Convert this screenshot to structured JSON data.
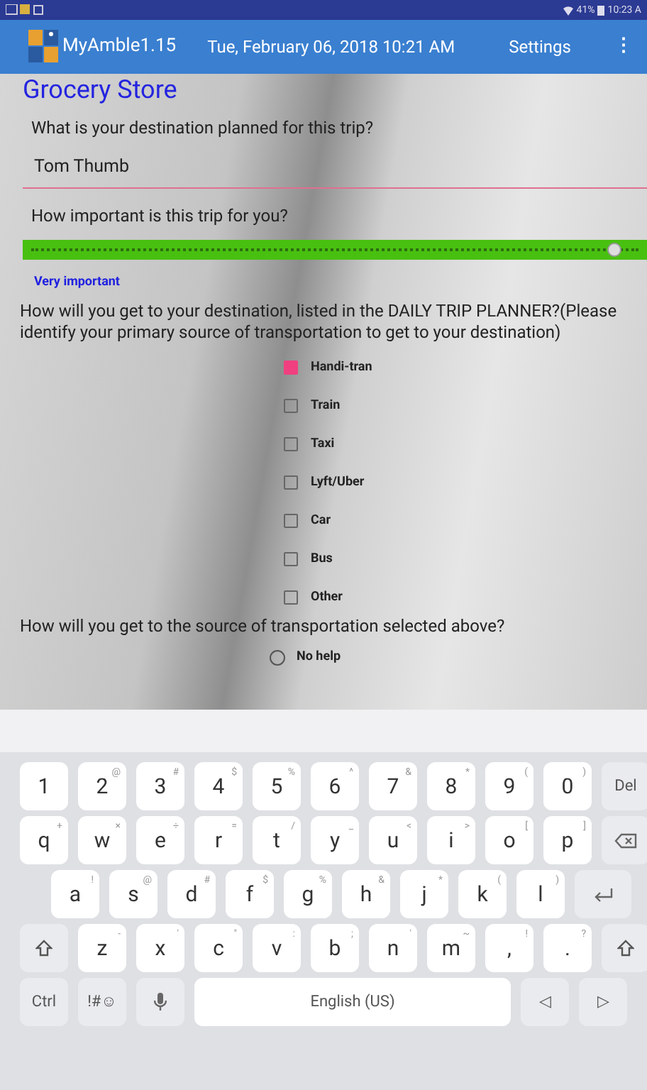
{
  "status_bar": {
    "battery": "41%",
    "time": "10:23 A"
  },
  "app_bar": {
    "title": "MyAmble1.15",
    "date": "Tue, February 06, 2018 10:21 AM",
    "settings": "Settings",
    "overflow": "⋮"
  },
  "form": {
    "title": "Grocery Store",
    "destination": {
      "question": "What is your destination planned for this trip?",
      "value": "Tom Thumb"
    },
    "importance": {
      "question": "How important is this trip for you?",
      "level": 0.96,
      "answer": "Very important"
    },
    "transport": {
      "question": "How will you get to your destination, listed in the DAILY TRIP PLANNER?(Please identify your primary source of transportation to get to your destination)",
      "options": [
        {
          "label": "Handi-tran",
          "checked": true
        },
        {
          "label": "Train",
          "checked": false
        },
        {
          "label": "Taxi",
          "checked": false
        },
        {
          "label": "Lyft/Uber",
          "checked": false
        },
        {
          "label": "Car",
          "checked": false
        },
        {
          "label": "Bus",
          "checked": false
        },
        {
          "label": "Other",
          "checked": false
        }
      ]
    },
    "help": {
      "question": "How will you get to the source of transportation selected above?",
      "options": [
        {
          "label": "No help",
          "selected": false
        }
      ]
    }
  },
  "keyboard": {
    "rows": [
      [
        {
          "kind": "char",
          "label": "1"
        },
        {
          "kind": "char",
          "label": "2",
          "hint": "@"
        },
        {
          "kind": "char",
          "label": "3",
          "hint": "#"
        },
        {
          "kind": "char",
          "label": "4",
          "hint": "$"
        },
        {
          "kind": "char",
          "label": "5",
          "hint": "%"
        },
        {
          "kind": "char",
          "label": "6",
          "hint": "^"
        },
        {
          "kind": "char",
          "label": "7",
          "hint": "&"
        },
        {
          "kind": "char",
          "label": "8",
          "hint": "*"
        },
        {
          "kind": "char",
          "label": "9",
          "hint": "("
        },
        {
          "kind": "char",
          "label": "0",
          "hint": ")"
        },
        {
          "kind": "func",
          "label": "Del"
        }
      ],
      [
        {
          "kind": "char",
          "label": "q",
          "hint": "+"
        },
        {
          "kind": "char",
          "label": "w",
          "hint": "×"
        },
        {
          "kind": "char",
          "label": "e",
          "hint": "÷"
        },
        {
          "kind": "char",
          "label": "r",
          "hint": "="
        },
        {
          "kind": "char",
          "label": "t",
          "hint": "/"
        },
        {
          "kind": "char",
          "label": "y",
          "hint": "_"
        },
        {
          "kind": "char",
          "label": "u",
          "hint": "<"
        },
        {
          "kind": "char",
          "label": "i",
          "hint": ">"
        },
        {
          "kind": "char",
          "label": "o",
          "hint": "["
        },
        {
          "kind": "char",
          "label": "p",
          "hint": "]"
        },
        {
          "kind": "backspace"
        }
      ],
      [
        {
          "kind": "char",
          "label": "a",
          "hint": "!"
        },
        {
          "kind": "char",
          "label": "s",
          "hint": "@"
        },
        {
          "kind": "char",
          "label": "d",
          "hint": "#"
        },
        {
          "kind": "char",
          "label": "f",
          "hint": "$"
        },
        {
          "kind": "char",
          "label": "g",
          "hint": "%"
        },
        {
          "kind": "char",
          "label": "h",
          "hint": "&"
        },
        {
          "kind": "char",
          "label": "j",
          "hint": "*"
        },
        {
          "kind": "char",
          "label": "k",
          "hint": "("
        },
        {
          "kind": "char",
          "label": "l",
          "hint": ")"
        },
        {
          "kind": "enter"
        }
      ],
      [
        {
          "kind": "shift"
        },
        {
          "kind": "char",
          "label": "z",
          "hint": "-"
        },
        {
          "kind": "char",
          "label": "x",
          "hint": "'"
        },
        {
          "kind": "char",
          "label": "c",
          "hint": "\""
        },
        {
          "kind": "char",
          "label": "v",
          "hint": ":"
        },
        {
          "kind": "char",
          "label": "b",
          "hint": ";"
        },
        {
          "kind": "char",
          "label": "n",
          "hint": "'"
        },
        {
          "kind": "char",
          "label": "m",
          "hint": "~"
        },
        {
          "kind": "char",
          "label": ",",
          "hint": "!"
        },
        {
          "kind": "char",
          "label": ".",
          "hint": "?"
        },
        {
          "kind": "shift"
        }
      ]
    ],
    "bottom_row": [
      {
        "kind": "func",
        "label": "Ctrl"
      },
      {
        "kind": "func",
        "label": "!#☺"
      },
      {
        "kind": "mic"
      },
      {
        "kind": "space",
        "label": "English (US)"
      },
      {
        "kind": "func",
        "label": "◁"
      },
      {
        "kind": "func",
        "label": "▷"
      }
    ]
  }
}
